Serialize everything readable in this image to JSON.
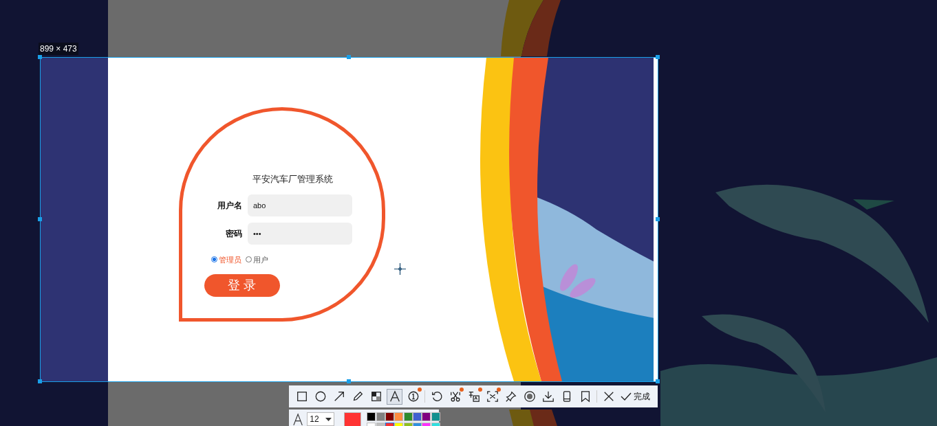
{
  "selection": {
    "size_label": "899 × 473"
  },
  "login": {
    "title": "平安汽车厂管理系统",
    "fields": [
      {
        "label": "用户名",
        "value": "abo"
      },
      {
        "label": "密码",
        "value": "•••"
      }
    ],
    "roles": [
      {
        "label": "管理员",
        "selected": true
      },
      {
        "label": "用户",
        "selected": false
      }
    ],
    "submit": "登 录"
  },
  "toolbar": {
    "tools": [
      {
        "kind": "rect",
        "selected": false,
        "badge": false
      },
      {
        "kind": "ellipse",
        "selected": false,
        "badge": false
      },
      {
        "kind": "arrow",
        "selected": false,
        "badge": false
      },
      {
        "kind": "pencil",
        "selected": false,
        "badge": false
      },
      {
        "kind": "mosaic",
        "selected": false,
        "badge": false
      },
      {
        "kind": "text",
        "selected": true,
        "badge": false
      },
      {
        "kind": "number",
        "selected": false,
        "badge": true
      },
      {
        "kind": "divider"
      },
      {
        "kind": "undo",
        "selected": false,
        "badge": false
      },
      {
        "kind": "cut",
        "selected": false,
        "badge": true
      },
      {
        "kind": "ocr",
        "selected": false,
        "badge": true
      },
      {
        "kind": "scan",
        "selected": false,
        "badge": true
      },
      {
        "kind": "pin",
        "selected": false,
        "badge": false
      },
      {
        "kind": "record",
        "selected": false,
        "badge": false
      },
      {
        "kind": "download",
        "selected": false,
        "badge": false
      },
      {
        "kind": "phone",
        "selected": false,
        "badge": false
      },
      {
        "kind": "bookmark",
        "selected": false,
        "badge": false
      },
      {
        "kind": "divider"
      },
      {
        "kind": "close",
        "selected": false,
        "badge": false
      }
    ],
    "done": "完成"
  },
  "text_options": {
    "font_size": "12",
    "palette": [
      {
        "color": "#000000",
        "selected": false
      },
      {
        "color": "#808080",
        "selected": false
      },
      {
        "color": "#800000",
        "selected": false
      },
      {
        "color": "#ff8c40",
        "selected": false
      },
      {
        "color": "#2e8b2e",
        "selected": false
      },
      {
        "color": "#4060d0",
        "selected": false
      },
      {
        "color": "#800080",
        "selected": false
      },
      {
        "color": "#109090",
        "selected": false
      },
      {
        "color": "#ffffff",
        "selected": false
      },
      {
        "color": "#c0c0c0",
        "selected": false
      },
      {
        "color": "#ff3333",
        "selected": true
      },
      {
        "color": "#ffff00",
        "selected": false
      },
      {
        "color": "#90c020",
        "selected": false
      },
      {
        "color": "#3090e0",
        "selected": false
      },
      {
        "color": "#ff30ff",
        "selected": false
      },
      {
        "color": "#30e0e0",
        "selected": false
      }
    ]
  }
}
